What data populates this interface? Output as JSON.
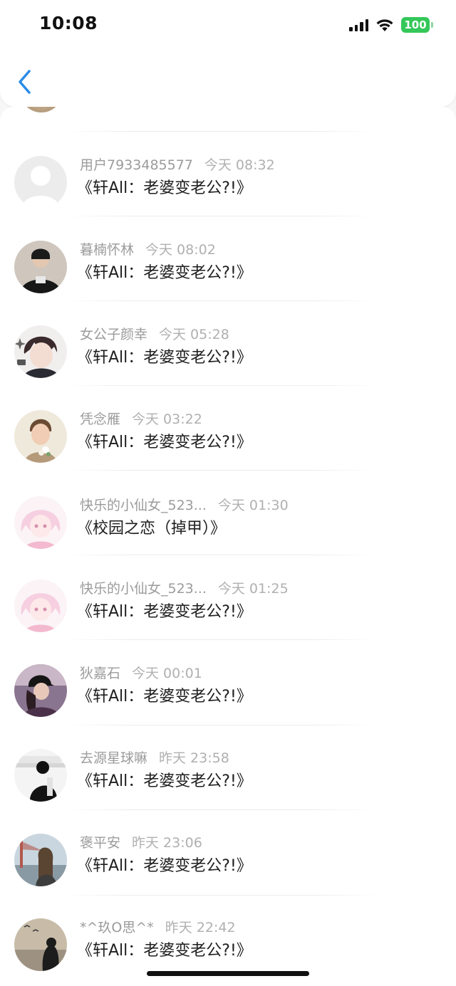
{
  "status_bar": {
    "time": "10:08",
    "battery": "100"
  },
  "header": {
    "back_icon": "chevron-left-icon"
  },
  "colors": {
    "accent": "#2b8ce6",
    "battery": "#34c759"
  },
  "messages": [
    {
      "user": "用户7933485577",
      "date": "今天 08:32",
      "text": "《轩All：老婆变老公?!》",
      "avatar": "default-avatar"
    },
    {
      "user": "暮楠怀林",
      "date": "今天 08:02",
      "text": "《轩All：老婆变老公?!》",
      "avatar": "photo"
    },
    {
      "user": "女公子颜幸",
      "date": "今天 05:28",
      "text": "《轩All：老婆变老公?!》",
      "avatar": "anime"
    },
    {
      "user": "凭念雁",
      "date": "今天 03:22",
      "text": "《轩All：老婆变老公?!》",
      "avatar": "photo"
    },
    {
      "user": "快乐的小仙女_523...",
      "date": "今天 01:30",
      "text": "《校园之恋（掉甲）》",
      "avatar": "anime-pink"
    },
    {
      "user": "快乐的小仙女_523...",
      "date": "今天 01:25",
      "text": "《轩All：老婆变老公?!》",
      "avatar": "anime-pink"
    },
    {
      "user": "狄嘉石",
      "date": "今天 00:01",
      "text": "《轩All：老婆变老公?!》",
      "avatar": "photo"
    },
    {
      "user": "去源星球嘛",
      "date": "昨天 23:58",
      "text": "《轩All：老婆变老公?!》",
      "avatar": "photo"
    },
    {
      "user": "褒平安",
      "date": "昨天 23:06",
      "text": "《轩All：老婆变老公?!》",
      "avatar": "photo"
    },
    {
      "user": "*^玖O思^*",
      "date": "昨天 22:42",
      "text": "《轩All：老婆变老公?!》",
      "avatar": "photo"
    }
  ]
}
